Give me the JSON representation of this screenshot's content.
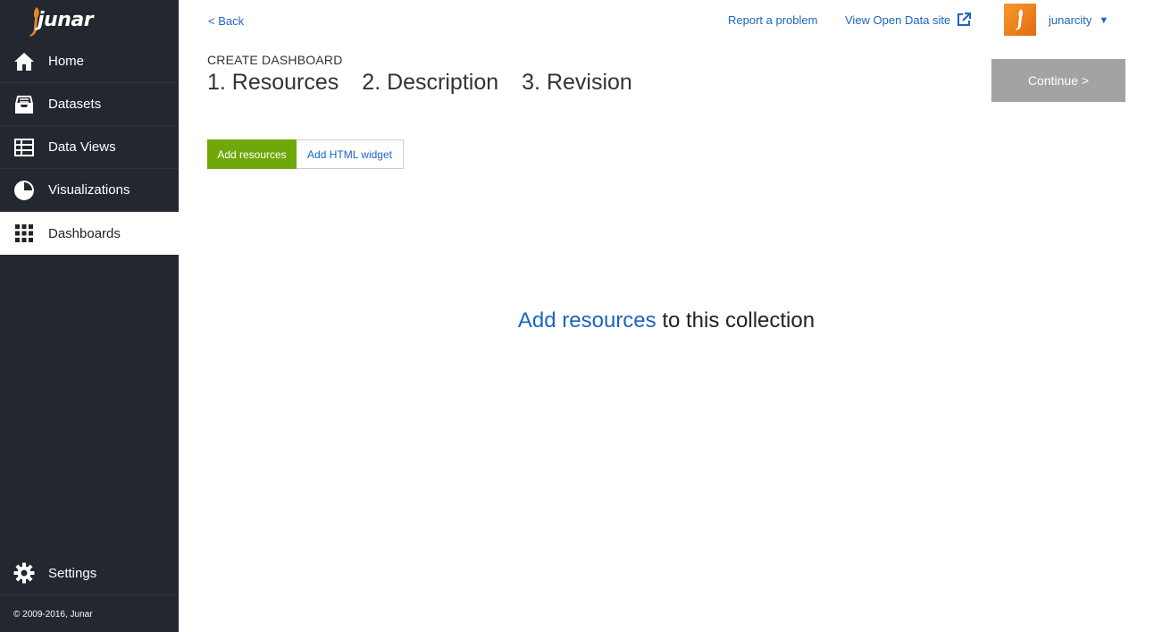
{
  "sidebar": {
    "logo_text": "junar",
    "items": [
      {
        "label": "Home",
        "icon": "home-icon"
      },
      {
        "label": "Datasets",
        "icon": "inbox-icon"
      },
      {
        "label": "Data Views",
        "icon": "table-icon"
      },
      {
        "label": "Visualizations",
        "icon": "pie-chart-icon"
      },
      {
        "label": "Dashboards",
        "icon": "grid-icon",
        "active": true
      }
    ],
    "settings_label": "Settings",
    "copyright": "© 2009-2016, Junar"
  },
  "topbar": {
    "back_label": "< Back",
    "report_label": "Report a problem",
    "open_data_label": "View Open Data site",
    "username": "junarcity"
  },
  "header": {
    "section_label": "CREATE DASHBOARD",
    "steps": [
      "1. Resources",
      "2. Description",
      "3. Revision"
    ],
    "continue_label": "Continue >"
  },
  "tabs": {
    "add_resources": "Add resources",
    "add_html_widget": "Add HTML widget"
  },
  "empty_state": {
    "link_text": "Add resources",
    "rest_text": " to this collection"
  },
  "colors": {
    "sidebar_bg": "#23272f",
    "link": "#1a66c0",
    "primary_tab": "#6fa80a",
    "continue_bg": "#a3a3a3",
    "avatar": "#f08020"
  }
}
